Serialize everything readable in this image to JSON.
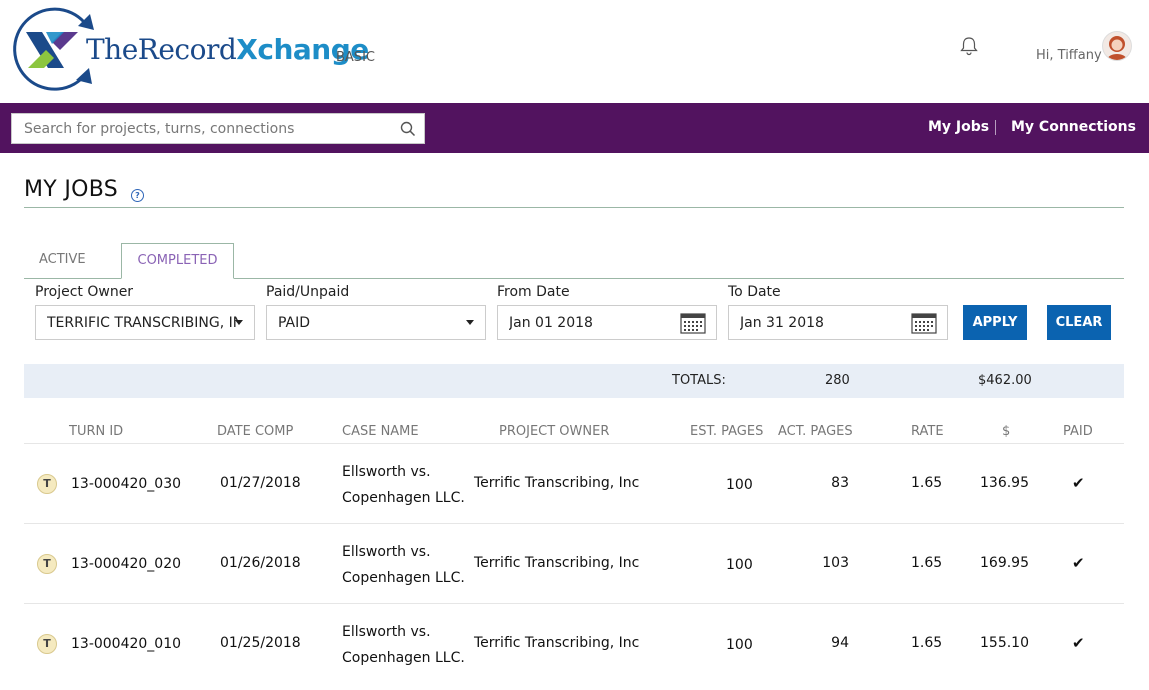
{
  "header": {
    "brand_prefix": "TheRecord",
    "brand_suffix": "Xchange",
    "tier": "BASIC",
    "greeting": "Hi, Tiffany"
  },
  "nav": {
    "search_placeholder": "Search for projects, turns, connections",
    "links": [
      "My Jobs",
      "My Connections"
    ]
  },
  "page": {
    "title": "MY JOBS",
    "help_glyph": "?"
  },
  "tabs": {
    "active": "ACTIVE",
    "completed": "COMPLETED",
    "selected": "COMPLETED"
  },
  "filters": {
    "project_owner": {
      "label": "Project Owner",
      "value": "TERRIFIC TRANSCRIBING, INC"
    },
    "paid_unpaid": {
      "label": "Paid/Unpaid",
      "value": "PAID"
    },
    "from_date": {
      "label": "From Date",
      "value": "Jan 01 2018"
    },
    "to_date": {
      "label": "To Date",
      "value": "Jan 31 2018"
    },
    "apply_label": "APPLY",
    "clear_label": "CLEAR"
  },
  "totals": {
    "label": "TOTALS:",
    "act_pages": "280",
    "amount": "$462.00"
  },
  "table": {
    "columns": [
      "TURN ID",
      "DATE COMP",
      "CASE NAME",
      "PROJECT OWNER",
      "EST. PAGES",
      "ACT. PAGES",
      "RATE",
      "$",
      "PAID"
    ],
    "rows": [
      {
        "badge": "T",
        "turn_id": "13-000420_030",
        "date": "01/27/2018",
        "case_line1": "Ellsworth vs.",
        "case_line2": "Copenhagen LLC.",
        "owner": "Terrific Transcribing, Inc",
        "est_pages": "100",
        "act_pages": "83",
        "rate": "1.65",
        "amount": "136.95",
        "paid": "✔"
      },
      {
        "badge": "T",
        "turn_id": "13-000420_020",
        "date": "01/26/2018",
        "case_line1": "Ellsworth vs.",
        "case_line2": "Copenhagen LLC.",
        "owner": "Terrific Transcribing, Inc",
        "est_pages": "100",
        "act_pages": "103",
        "rate": "1.65",
        "amount": "169.95",
        "paid": "✔"
      },
      {
        "badge": "T",
        "turn_id": "13-000420_010",
        "date": "01/25/2018",
        "case_line1": "Ellsworth vs.",
        "case_line2": "Copenhagen LLC.",
        "owner": "Terrific Transcribing, Inc",
        "est_pages": "100",
        "act_pages": "94",
        "rate": "1.65",
        "amount": "155.10",
        "paid": "✔"
      }
    ]
  },
  "colors": {
    "nav_bg": "#52135f",
    "button": "#0b63b0",
    "totals_bg": "#e8eef6",
    "tab_selected_text": "#8a63b5"
  }
}
